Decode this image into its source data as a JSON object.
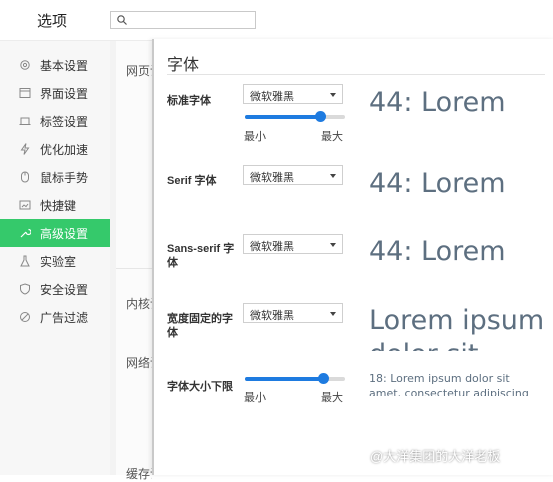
{
  "app": {
    "title": "选项"
  },
  "search": {
    "placeholder": ""
  },
  "sidebar": {
    "items": [
      {
        "label": "基本设置",
        "icon": "gear-icon"
      },
      {
        "label": "界面设置",
        "icon": "window-icon"
      },
      {
        "label": "标签设置",
        "icon": "tab-icon"
      },
      {
        "label": "优化加速",
        "icon": "lightning-icon"
      },
      {
        "label": "鼠标手势",
        "icon": "mouse-icon"
      },
      {
        "label": "快捷键",
        "icon": "keyboard-icon"
      },
      {
        "label": "高级设置",
        "icon": "wrench-icon",
        "active": true
      },
      {
        "label": "实验室",
        "icon": "flask-icon"
      },
      {
        "label": "安全设置",
        "icon": "shield-icon"
      },
      {
        "label": "广告过滤",
        "icon": "block-icon"
      }
    ]
  },
  "behind": {
    "labels": [
      "网页设置",
      "内核设置",
      "网络设置",
      "缓存设置"
    ]
  },
  "font_dialog": {
    "title": "字体",
    "standard": {
      "label": "标准字体",
      "value": "微软雅黑",
      "preview": "44: Lorem"
    },
    "size_slider": {
      "min_label": "最小",
      "max_label": "最大",
      "value_percent": 75
    },
    "serif": {
      "label": "Serif 字体",
      "value": "微软雅黑",
      "preview": "44: Lorem"
    },
    "sans_serif": {
      "label": "Sans-serif 字体",
      "value": "微软雅黑",
      "preview": "44: Lorem"
    },
    "fixed": {
      "label": "宽度固定的字体",
      "value": "微软雅黑",
      "preview": "Lorem ipsum",
      "preview_cut": "dolor sit"
    },
    "min_size": {
      "label": "字体大小下限",
      "min_label": "最小",
      "max_label": "最大",
      "value_percent": 78,
      "preview_line1": "18: Lorem ipsum dolor sit",
      "preview_line2": "amet, consectetur adipiscing"
    }
  },
  "watermark": {
    "text": "@大洋集团的大洋老板"
  },
  "colors": {
    "accent": "#35c96b",
    "slider": "#1e7be0",
    "preview_text": "#5d6f80"
  }
}
